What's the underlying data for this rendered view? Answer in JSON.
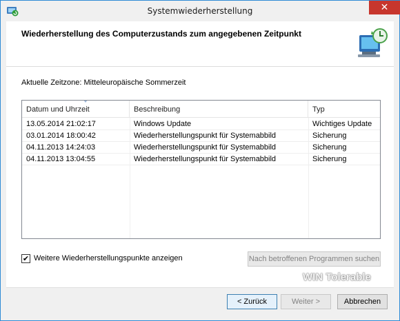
{
  "window": {
    "title": "Systemwiederherstellung",
    "close_glyph": "✕"
  },
  "header": {
    "title": "Wiederherstellung des Computerzustands zum angegebenen Zeitpunkt"
  },
  "timezone": {
    "label": "Aktuelle Zeitzone: Mitteleuropäische Sommerzeit"
  },
  "table": {
    "columns": [
      "Datum und Uhrzeit",
      "Beschreibung",
      "Typ"
    ],
    "rows": [
      [
        "13.05.2014 21:02:17",
        "Windows Update",
        "Wichtiges Update"
      ],
      [
        "03.01.2014 18:00:42",
        "Wiederherstellungspunkt für Systemabbild",
        "Sicherung"
      ],
      [
        "04.11.2013 14:24:03",
        "Wiederherstellungspunkt für Systemabbild",
        "Sicherung"
      ],
      [
        "04.11.2013 13:04:55",
        "Wiederherstellungspunkt für Systemabbild",
        "Sicherung"
      ]
    ]
  },
  "options": {
    "show_more_label": "Weitere Wiederherstellungspunkte anzeigen",
    "show_more_checked": true,
    "check_glyph": "✔",
    "scan_button": "Nach betroffenen Programmen suchen"
  },
  "buttons": {
    "back": "< Zurück",
    "next": "Weiter >",
    "cancel": "Abbrechen"
  },
  "watermark": {
    "text": "WIN Tolerable"
  },
  "icons": {
    "title_icon": "system-restore-icon",
    "header_icon": "computer-restore-icon"
  },
  "colors": {
    "close": "#c7362d",
    "border": "#2e8bd6"
  }
}
